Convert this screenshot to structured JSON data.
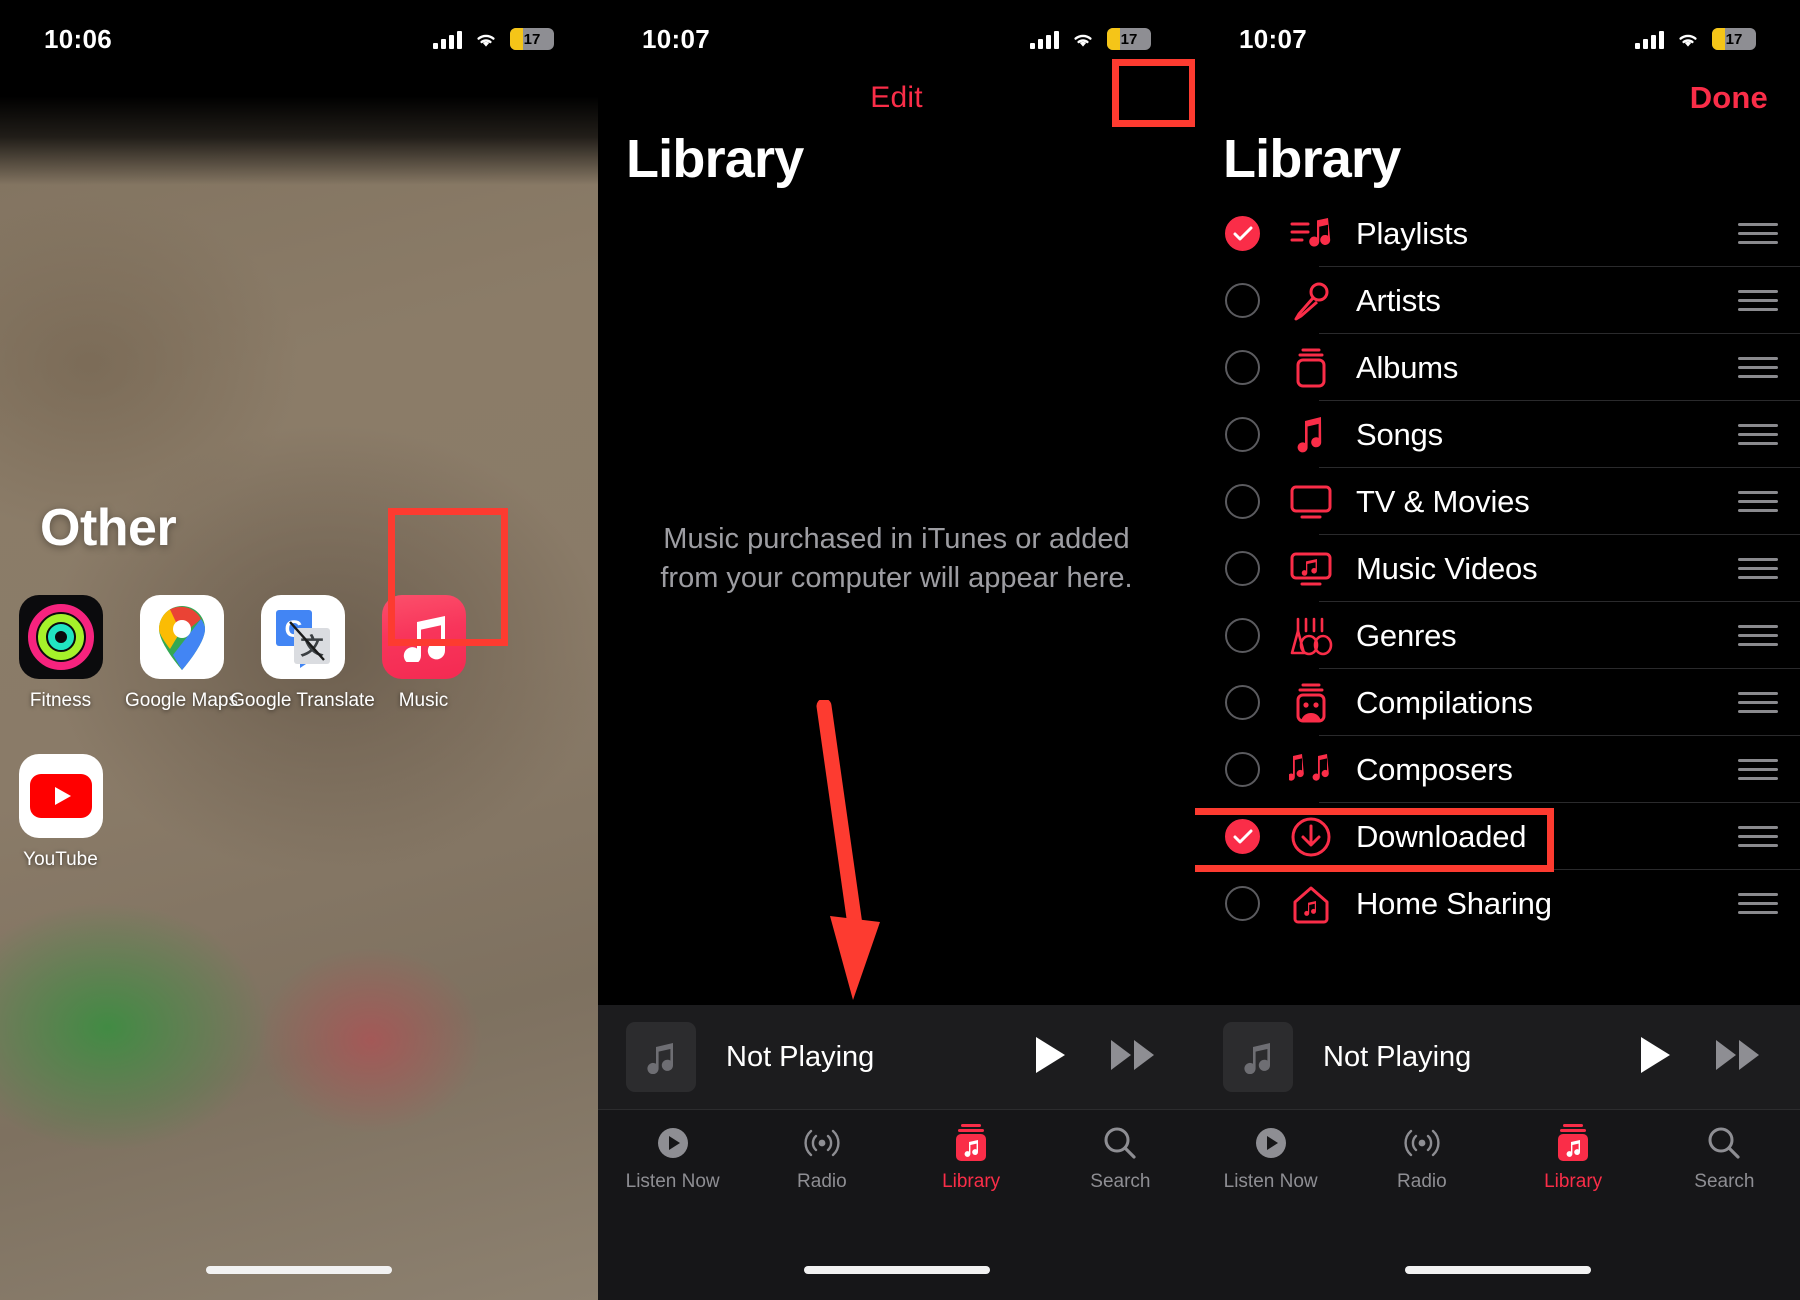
{
  "panels": [
    {
      "name": "home-screen-folder",
      "status": {
        "time": "10:06",
        "battery": "17"
      },
      "folder_title": "Other",
      "apps": [
        {
          "label": "Fitness",
          "icon": "fitness-icon"
        },
        {
          "label": "Google Maps",
          "icon": "google-maps-icon"
        },
        {
          "label": "Google Translate",
          "icon": "google-translate-icon"
        },
        {
          "label": "Music",
          "icon": "music-icon",
          "highlighted": true
        },
        {
          "label": "YouTube",
          "icon": "youtube-icon"
        }
      ]
    },
    {
      "name": "music-library-empty",
      "status": {
        "time": "10:07",
        "battery": "17"
      },
      "edit_label": "Edit",
      "title": "Library",
      "empty_message": "Music purchased in iTunes or added from your computer will appear here."
    },
    {
      "name": "music-library-edit",
      "status": {
        "time": "10:07",
        "battery": "17"
      },
      "done_label": "Done",
      "title": "Library",
      "rows": [
        {
          "label": "Playlists",
          "icon": "playlist-icon",
          "checked": true
        },
        {
          "label": "Artists",
          "icon": "microphone-icon",
          "checked": false
        },
        {
          "label": "Albums",
          "icon": "album-icon",
          "checked": false
        },
        {
          "label": "Songs",
          "icon": "note-icon",
          "checked": false
        },
        {
          "label": "TV & Movies",
          "icon": "tv-icon",
          "checked": false
        },
        {
          "label": "Music Videos",
          "icon": "music-video-icon",
          "checked": false
        },
        {
          "label": "Genres",
          "icon": "guitar-icon",
          "checked": false
        },
        {
          "label": "Compilations",
          "icon": "compilation-icon",
          "checked": false
        },
        {
          "label": "Composers",
          "icon": "notes-icon",
          "checked": false
        },
        {
          "label": "Downloaded",
          "icon": "download-icon",
          "checked": true,
          "highlighted": true
        },
        {
          "label": "Home Sharing",
          "icon": "home-share-icon",
          "checked": false
        }
      ]
    }
  ],
  "miniplayer": {
    "title": "Not Playing",
    "play_icon": "play-icon",
    "next_icon": "fast-forward-icon",
    "art_icon": "note-icon"
  },
  "tabbar": {
    "tabs": [
      {
        "label": "Listen Now",
        "icon": "listen-now-icon",
        "active": false
      },
      {
        "label": "Radio",
        "icon": "radio-icon",
        "active": false
      },
      {
        "label": "Library",
        "icon": "library-icon",
        "active": true
      },
      {
        "label": "Search",
        "icon": "search-icon",
        "active": false
      }
    ]
  },
  "colors": {
    "accent_red": "#fa2d48",
    "annotation_red": "#fd3b30",
    "tab_inactive": "#8e8e93",
    "battery_yellow": "#f5c518"
  }
}
